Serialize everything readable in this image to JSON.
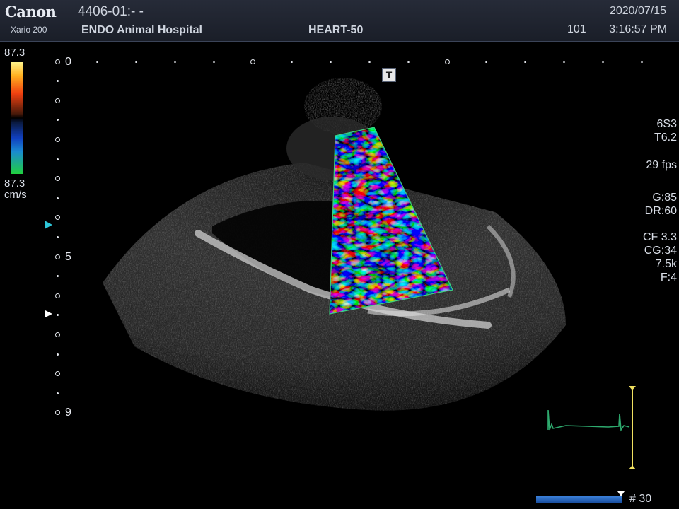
{
  "header": {
    "brand": "Canon",
    "model": "Xario 200",
    "patient_id": "4406-01:- -",
    "hospital": "ENDO Animal Hospital",
    "preset": "HEART-50",
    "date": "2020/07/15",
    "frame_no": "101",
    "time": "3:16:57 PM"
  },
  "color_scale": {
    "top_value": "87.3",
    "bottom_value": "87.3",
    "unit": "cm/s"
  },
  "depth_scale": {
    "labels": [
      "0",
      "5",
      "9"
    ]
  },
  "indicators": {
    "t_icon": "T"
  },
  "parameters": {
    "probe": "6S3",
    "t": "T6.2",
    "fps": "29 fps",
    "gain": "G:85",
    "dynamic_range": "DR:60",
    "cf": "CF 3.3",
    "cg": "CG:34",
    "prf": "7.5k",
    "filter": "F:4"
  },
  "cine": {
    "frame_count": "# 30",
    "position_fraction": 1.0
  },
  "colors": {
    "ecg_trace": "#2eaa6e",
    "ecg_marker": "#f0e060",
    "roi_outline": "#3cd080",
    "accent_arrow": "#2ec6d8"
  }
}
